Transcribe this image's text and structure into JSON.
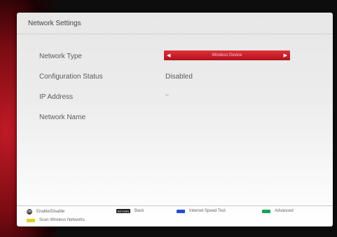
{
  "window": {
    "title": "Network Settings"
  },
  "rows": [
    {
      "label": "Network Type",
      "value": "Wireless Device"
    },
    {
      "label": "Configuration Status",
      "value": "Disabled"
    },
    {
      "label": "IP Address",
      "value": "--"
    },
    {
      "label": "Network Name",
      "value": ""
    }
  ],
  "footer": {
    "enable": {
      "icon": "ok-icon",
      "label": "Enable/Disable"
    },
    "back": {
      "icon": "return-icon",
      "icon_text": "RETURN",
      "label": "Back"
    },
    "speed": {
      "color": "#2a4bd1",
      "label": "Internet Speed Test"
    },
    "advanced": {
      "color": "#1aa15a",
      "label": "Advanced"
    },
    "scan": {
      "color": "#e3cf2a",
      "label": "Scan Wireless Networks"
    }
  },
  "colors": {
    "accent": "#d11c28"
  }
}
